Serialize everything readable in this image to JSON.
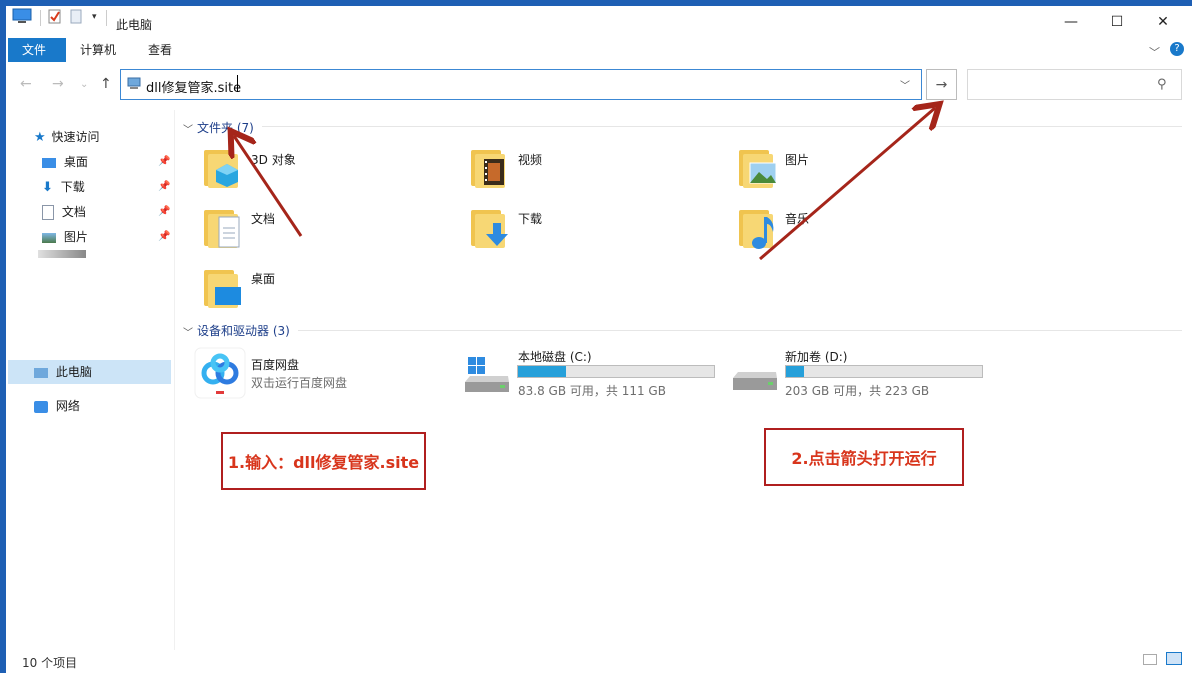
{
  "window": {
    "title": "此电脑"
  },
  "ribbon": {
    "tabs": [
      "文件",
      "计算机",
      "查看"
    ]
  },
  "address": {
    "value": "dll修复管家.site",
    "go_arrow": "→"
  },
  "search": {
    "placeholder": ""
  },
  "sidebar": {
    "items": [
      {
        "label": "快速访问",
        "icon": "star-icon"
      },
      {
        "label": "桌面",
        "icon": "desktop-icon",
        "pinned": true
      },
      {
        "label": "下载",
        "icon": "download-icon",
        "pinned": true
      },
      {
        "label": "文档",
        "icon": "document-icon",
        "pinned": true
      },
      {
        "label": "图片",
        "icon": "pictures-icon",
        "pinned": true
      },
      {
        "label": "此电脑",
        "icon": "computer-icon",
        "selected": true
      },
      {
        "label": "网络",
        "icon": "network-icon"
      }
    ]
  },
  "folders_group": {
    "title": "文件夹 (7)",
    "folders": [
      {
        "name": "3D 对象",
        "icon": "3d-objects-folder-icon"
      },
      {
        "name": "视频",
        "icon": "videos-folder-icon"
      },
      {
        "name": "图片",
        "icon": "pictures-folder-icon"
      },
      {
        "name": "文档",
        "icon": "documents-folder-icon"
      },
      {
        "name": "下载",
        "icon": "downloads-folder-icon"
      },
      {
        "name": "音乐",
        "icon": "music-folder-icon"
      },
      {
        "name": "桌面",
        "icon": "desktop-folder-icon"
      }
    ]
  },
  "devices_group": {
    "title": "设备和驱动器 (3)",
    "baidu": {
      "name": "百度网盘",
      "sub": "双击运行百度网盘"
    },
    "drives": [
      {
        "name": "本地磁盘 (C:)",
        "info": "83.8 GB 可用，共 111 GB",
        "used_fraction": 0.245
      },
      {
        "name": "新加卷 (D:)",
        "info": "203 GB 可用，共 223 GB",
        "used_fraction": 0.09
      }
    ]
  },
  "annotations": {
    "step1": "1.输入：dll修复管家.site",
    "step2": "2.点击箭头打开运行"
  },
  "status": {
    "item_count": "10 个项目"
  },
  "colors": {
    "accent": "#1979ca",
    "annotation_red": "#b01f1f",
    "selected": "#cce4f7",
    "drive_bar": "#26a0da"
  }
}
